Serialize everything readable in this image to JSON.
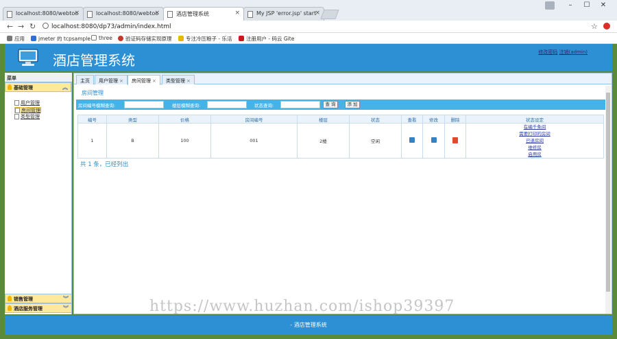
{
  "browser": {
    "tabs": [
      {
        "label": "localhost:8080/webtoo"
      },
      {
        "label": "localhost:8080/webtoo"
      },
      {
        "label": "酒店管理系统"
      },
      {
        "label": "My JSP 'error.jsp' start"
      }
    ],
    "url": "localhost:8080/dp73/admin/index.html",
    "bookmarks": [
      {
        "label": "应用"
      },
      {
        "label": "jmeter 的 tcpsample"
      },
      {
        "label": "three"
      },
      {
        "label": "验证码存储实现原理"
      },
      {
        "label": "专注冷压粮子 - 乐活"
      },
      {
        "label": "注册用户 - 码云 Gite"
      }
    ]
  },
  "app": {
    "title": "酒店管理系统",
    "user_links": [
      "修改密码",
      "注销(admin)"
    ],
    "footer": "- 酒店管理系统"
  },
  "sidebar": {
    "header": "菜单",
    "groups": [
      {
        "label": "基础管理",
        "items": [
          "用户管理",
          "房间管理",
          "类型管理"
        ]
      },
      {
        "label": "销售管理"
      },
      {
        "label": "酒店服务管理"
      }
    ]
  },
  "page_tabs": [
    {
      "label": "主页"
    },
    {
      "label": "用户管理"
    },
    {
      "label": "房间管理"
    },
    {
      "label": "类型管理"
    }
  ],
  "content": {
    "title": "房间管理",
    "search": {
      "room_label": "房间编号模糊查询:",
      "floor_label": "楼层模糊查询:",
      "status_label": "状态查询:",
      "query_button": "查 询",
      "add_button": "添 加"
    },
    "table": {
      "headers": [
        "编号",
        "类型",
        "价格",
        "房间编号",
        "楼层",
        "状态",
        "查看",
        "修改",
        "删除",
        "状态设定"
      ],
      "rows": [
        {
          "id": "1",
          "type": "B",
          "price": "100",
          "room_no": "001",
          "floor": "2楼",
          "status": "空闲",
          "status_actions": [
            "在编千条间",
            "需要打印的房间",
            "已退房间",
            "维修房",
            "启用房"
          ]
        }
      ]
    },
    "summary": "共 1 条，已经列出"
  },
  "watermark": "https://www.huzhan.com/ishop39397"
}
